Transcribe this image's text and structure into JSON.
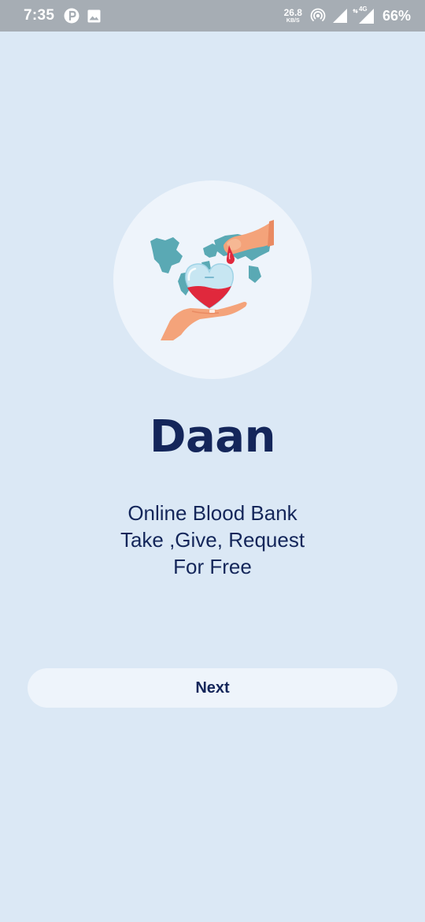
{
  "status_bar": {
    "time": "7:35",
    "net_speed_value": "26.8",
    "net_speed_unit": "KB/S",
    "network_type": "4G",
    "battery": "66%",
    "icons": [
      "pinterest-icon",
      "image-icon",
      "hotspot-icon",
      "signal-icon",
      "lte-signal-icon"
    ]
  },
  "hero": {
    "illustration": "blood-donation-heart-world-map"
  },
  "app": {
    "name": "Daan",
    "tagline_lines": [
      "Online Blood Bank",
      "Take ,Give, Request",
      "For Free"
    ]
  },
  "actions": {
    "next_label": "Next"
  },
  "colors": {
    "background": "#dbe8f5",
    "status_bar": "#a6adb4",
    "card": "#eef4fb",
    "text_primary": "#14265a",
    "blood_red": "#e0283c",
    "map_teal": "#5aa9b4",
    "skin": "#f4a37a"
  }
}
